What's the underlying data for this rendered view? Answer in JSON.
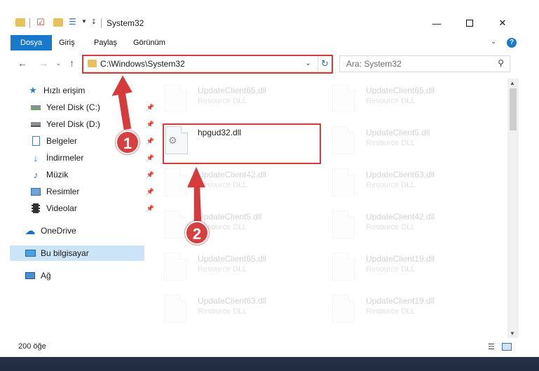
{
  "window": {
    "title": "System32"
  },
  "ribbon": {
    "tabs": [
      "Dosya",
      "Giriş",
      "Paylaş",
      "Görünüm"
    ],
    "help": "?"
  },
  "nav": {
    "address": "C:\\Windows\\System32",
    "search_placeholder": "Ara: System32"
  },
  "sidebar": {
    "items": [
      {
        "label": "Hızlı erişim",
        "icon": "star-icon",
        "pinned": false
      },
      {
        "label": "Yerel Disk (C:)",
        "icon": "drive-icon",
        "pinned": true
      },
      {
        "label": "Yerel Disk (D:)",
        "icon": "drive-icon",
        "pinned": true
      },
      {
        "label": "Belgeler",
        "icon": "documents-icon",
        "pinned": true
      },
      {
        "label": "İndirmeler",
        "icon": "download-icon",
        "pinned": true
      },
      {
        "label": "Müzik",
        "icon": "music-icon",
        "pinned": true
      },
      {
        "label": "Resimler",
        "icon": "pictures-icon",
        "pinned": true
      },
      {
        "label": "Videolar",
        "icon": "videos-icon",
        "pinned": true
      },
      {
        "label": "OneDrive",
        "icon": "cloud-icon",
        "pinned": false
      },
      {
        "label": "Bu bilgisayar",
        "icon": "computer-icon",
        "pinned": false
      },
      {
        "label": "Ağ",
        "icon": "network-icon",
        "pinned": false
      }
    ]
  },
  "files": {
    "col1": [
      {
        "name": "UpdateClient65.dll",
        "type": "Resource DLL"
      },
      {
        "name": "hpgud32.dll",
        "type": ""
      },
      {
        "name": "UpdateClient42.dll",
        "type": "Resource DLL"
      },
      {
        "name": "UpdateClient5.dll",
        "type": "Resource DLL"
      },
      {
        "name": "UpdateClient65.dll",
        "type": "Resource DLL"
      },
      {
        "name": "UpdateClient63.dll",
        "type": "Resource DLL"
      }
    ],
    "col2": [
      {
        "name": "UpdateClient65.dll",
        "type": "Resource DLL"
      },
      {
        "name": "UpdateClient5.dll",
        "type": "Resource DLL"
      },
      {
        "name": "UpdateClient63.dll",
        "type": "Resource DLL"
      },
      {
        "name": "UpdateClient42.dll",
        "type": "Resource DLL"
      },
      {
        "name": "UpdateClient19.dll",
        "type": "Resource DLL"
      },
      {
        "name": "UpdateClient19.dll",
        "type": "Resource DLL"
      }
    ]
  },
  "status": {
    "count": "200 öğe"
  },
  "annotations": {
    "badge1": "1",
    "badge2": "2",
    "color": "#d63a3a"
  }
}
